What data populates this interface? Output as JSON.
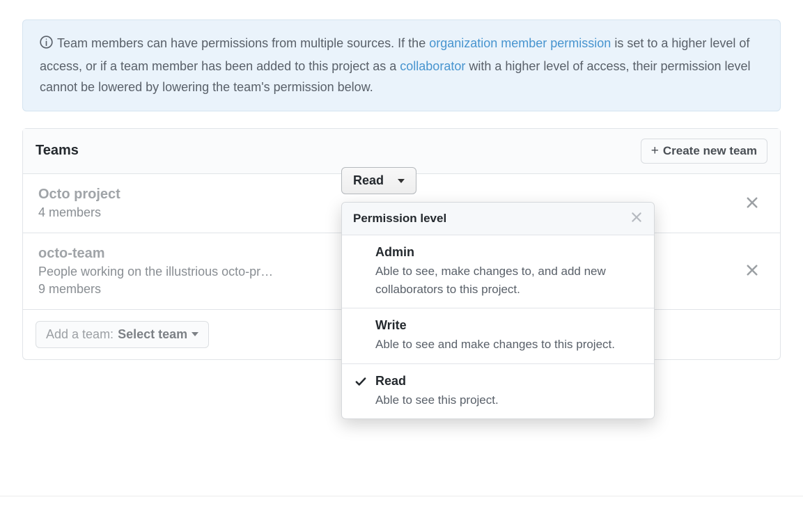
{
  "info": {
    "text_prefix": "Team members can have permissions from multiple sources. If the ",
    "link1": "organization member permission",
    "text_mid1": " is set to a higher level of access, or if a team member has been added to this project as a ",
    "link2": "collaborator",
    "text_suffix": " with a higher level of access, their permission level cannot be lowered by lowering the team's permission below."
  },
  "teams_header": {
    "title": "Teams",
    "create_button": "Create new team"
  },
  "teams": [
    {
      "name": "Octo project",
      "description": "",
      "members": "4 members",
      "permission": "Read"
    },
    {
      "name": "octo-team",
      "description": "People working on the illustrious octo-pr…",
      "members": "9 members",
      "permission": ""
    }
  ],
  "add_team": {
    "prefix": "Add a team: ",
    "select_label": "Select team"
  },
  "popover": {
    "title": "Permission level",
    "options": [
      {
        "label": "Admin",
        "description": "Able to see, make changes to, and add new collaborators to this project.",
        "selected": false
      },
      {
        "label": "Write",
        "description": "Able to see and make changes to this project.",
        "selected": false
      },
      {
        "label": "Read",
        "description": "Able to see this project.",
        "selected": true
      }
    ]
  }
}
